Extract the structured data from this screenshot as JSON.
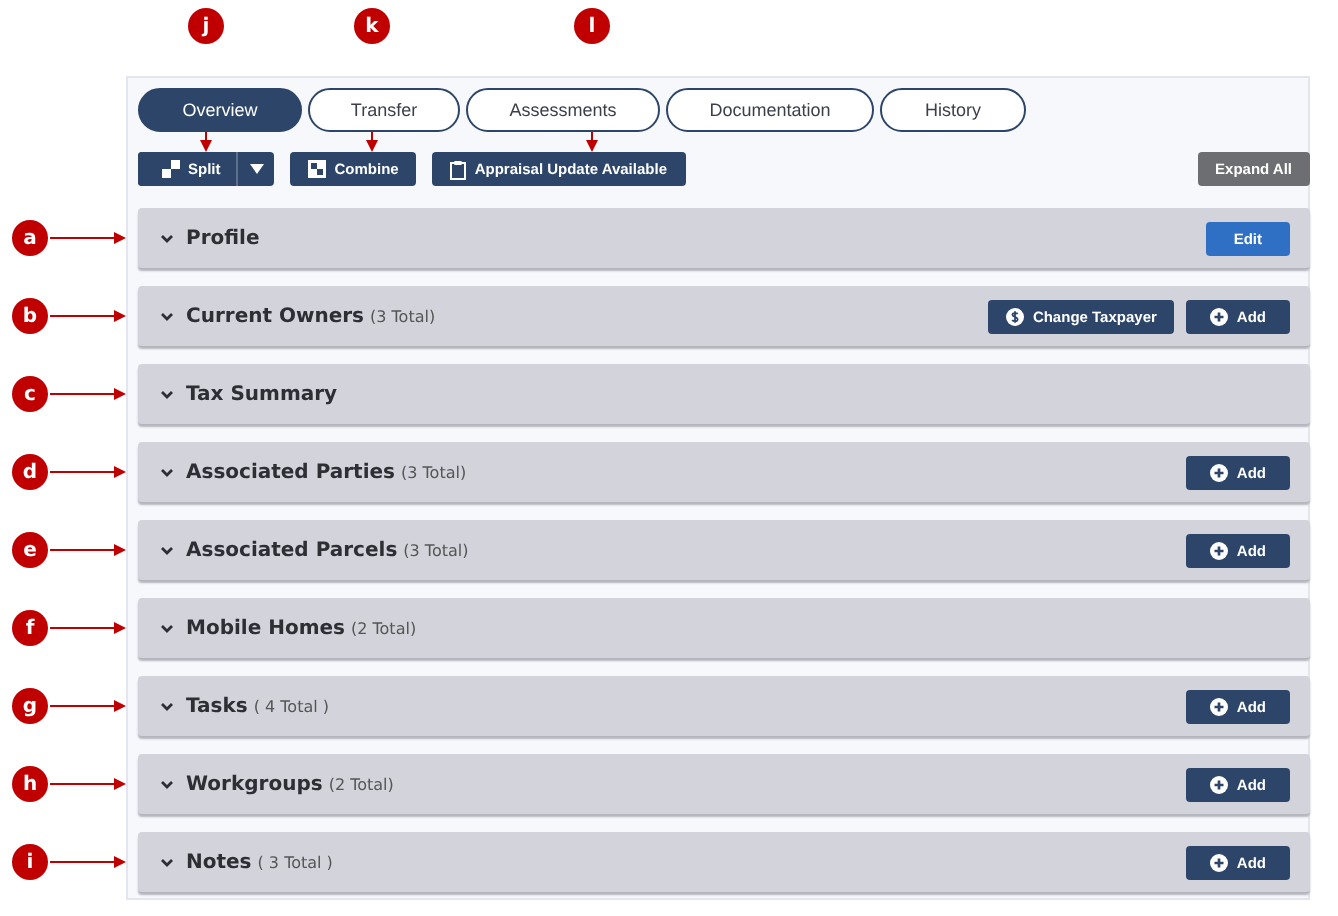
{
  "top_callouts": [
    {
      "label": "j"
    },
    {
      "label": "k"
    },
    {
      "label": "l"
    }
  ],
  "tabs": [
    {
      "label": "Overview",
      "selected": true
    },
    {
      "label": "Transfer",
      "selected": false
    },
    {
      "label": "Assessments",
      "selected": false
    },
    {
      "label": "Documentation",
      "selected": false
    },
    {
      "label": "History",
      "selected": false
    }
  ],
  "toolbar": [
    {
      "kind": "split",
      "label": "Split"
    },
    {
      "kind": "combine",
      "label": "Combine"
    },
    {
      "kind": "appraisal",
      "label": "Appraisal Update Available"
    }
  ],
  "expand_all_button": "Expand All",
  "sections": [
    {
      "callout": "a",
      "title": "Profile",
      "buttons": [
        {
          "kind": "edit",
          "label": "Edit"
        }
      ]
    },
    {
      "callout": "b",
      "title": "Current Owners",
      "count": "(3 Total)",
      "buttons": [
        {
          "kind": "taxpayer",
          "label": "Change Taxpayer"
        },
        {
          "kind": "add",
          "label": "Add"
        }
      ]
    },
    {
      "callout": "c",
      "title": "Tax Summary"
    },
    {
      "callout": "d",
      "title": "Associated Parties",
      "count": "(3 Total)",
      "buttons": [
        {
          "kind": "add",
          "label": "Add"
        }
      ]
    },
    {
      "callout": "e",
      "title": "Associated Parcels",
      "count": "(3 Total)",
      "buttons": [
        {
          "kind": "add",
          "label": "Add"
        }
      ]
    },
    {
      "callout": "f",
      "title": "Mobile Homes",
      "count": "(2 Total)"
    },
    {
      "callout": "g",
      "title": "Tasks",
      "count": "( 4 Total )",
      "buttons": [
        {
          "kind": "add",
          "label": "Add"
        }
      ]
    },
    {
      "callout": "h",
      "title": "Workgroups",
      "count": "(2 Total)",
      "buttons": [
        {
          "kind": "add",
          "label": "Add"
        }
      ]
    },
    {
      "callout": "i",
      "title": "Notes",
      "count": "( 3 Total )",
      "buttons": [
        {
          "kind": "add",
          "label": "Add"
        }
      ]
    }
  ]
}
